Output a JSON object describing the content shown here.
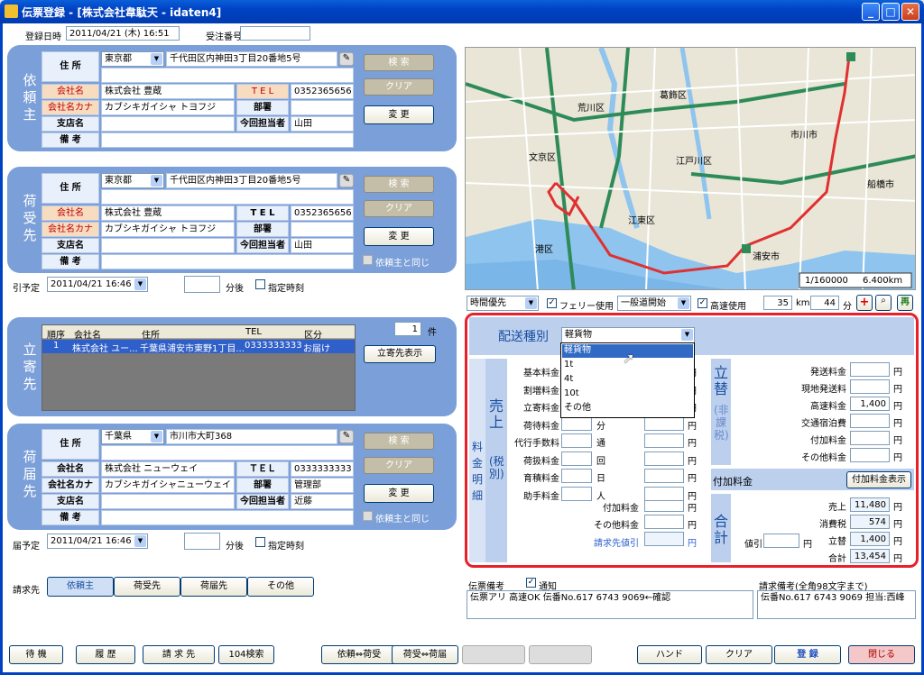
{
  "window": {
    "title": "伝票登録 - [株式会社韋駄天 - idaten4]",
    "min": "_",
    "max": "□",
    "close": "✕"
  },
  "header": {
    "reg_label": "登録日時",
    "reg_value": "2011/04/21 (木) 16:51",
    "order_label": "受注番号",
    "order_value": ""
  },
  "labels": {
    "address": "住 所",
    "company": "会社名",
    "kana": "会社名カナ",
    "tel": "T E L",
    "dept": "部署",
    "branch": "支店名",
    "person": "今回担当者",
    "note": "備 考",
    "search": "検 索",
    "clear": "クリア",
    "change": "変 更",
    "same": "依頼主と同じ",
    "min_after": "分後",
    "specify_time": "指定時刻",
    "tel2": "ＴＥＬ"
  },
  "irai": {
    "title": "依頼主",
    "pref": "東京都",
    "address": "千代田区内神田3丁目20番地5号",
    "company": "株式会社 豊蔵",
    "tel": "0352365656",
    "kana": "カブシキガイシャ トヨフジ",
    "dept": "",
    "branch": "",
    "person": "山田",
    "note": ""
  },
  "niuke": {
    "title": "荷受先",
    "pref": "東京都",
    "address": "千代田区内神田3丁目20番地5号",
    "company": "株式会社 豊蔵",
    "tel": "0352365656",
    "kana": "カブシキガイシャ トヨフジ",
    "dept": "",
    "branch": "",
    "person": "山田",
    "note": ""
  },
  "pickup": {
    "label": "引予定",
    "date": "2011/04/21 16:46",
    "min": ""
  },
  "tachiyori": {
    "title": "立寄先",
    "count": "1",
    "count_unit": "件",
    "headers": [
      "順序",
      "会社名",
      "住所",
      "TEL",
      "区分"
    ],
    "rows": [
      [
        "1",
        "株式会社 ユー...",
        "千葉県浦安市東野1丁目...",
        "0333333333",
        "お届け"
      ]
    ],
    "show_btn": "立寄先表示"
  },
  "nitodoke": {
    "title": "荷届先",
    "pref": "千葉県",
    "address": "市川市大町368",
    "company": "株式会社 ニューウェイ",
    "tel": "0333333333",
    "kana": "カブシキガイシャニューウェイ",
    "dept": "管理部",
    "branch": "",
    "person": "近藤",
    "note": ""
  },
  "delivery": {
    "label": "届予定",
    "date": "2011/04/21 16:46",
    "min": ""
  },
  "billing": {
    "label": "請求先",
    "buttons": [
      "依頼主",
      "荷受先",
      "荷届先",
      "その他"
    ]
  },
  "map": {
    "scale": "1/160000",
    "dist": "6.400km",
    "places": [
      "葛飾区",
      "荒川区",
      "江戸川区",
      "文京区",
      "市川市",
      "船橋市",
      "江東区",
      "浦安市",
      "港区"
    ]
  },
  "route": {
    "priority": "時間優先",
    "ferry": "フェリー使用",
    "general": "一般道開始",
    "highway": "高速使用",
    "km": "35",
    "km_unit": "km",
    "min": "44",
    "min_unit": "分",
    "plus": "+",
    "re": "再"
  },
  "fee": {
    "type_label": "配送種別",
    "type_value": "軽貨物",
    "options": [
      "軽貨物",
      "1t",
      "4t",
      "10t",
      "その他"
    ],
    "sales_title": "売上",
    "detail_title": "料金明細",
    "tax_title": "(税別)",
    "left_items": [
      {
        "label": "基本料金",
        "value": "",
        "unit": ""
      },
      {
        "label": "割増料金",
        "value": "",
        "unit": ""
      },
      {
        "label": "立寄料金",
        "value": "",
        "unit": ""
      },
      {
        "label": "荷待料金",
        "value": "",
        "unit": "分"
      },
      {
        "label": "代行手数料",
        "value": "",
        "unit": "通"
      },
      {
        "label": "荷扱料金",
        "value": "",
        "unit": "回"
      },
      {
        "label": "育積料金",
        "value": "",
        "unit": "日"
      },
      {
        "label": "助手料金",
        "value": "",
        "unit": "人"
      }
    ],
    "mid_values": [
      "",
      "",
      "",
      "",
      "",
      "",
      "",
      ""
    ],
    "extra": [
      {
        "label": "付加料金",
        "value": ""
      },
      {
        "label": "その他料金",
        "value": ""
      },
      {
        "label": "請求先値引",
        "value": ""
      }
    ],
    "yen": "円",
    "tate_title": "立替",
    "tate_sub": "(非課税)",
    "right_items": [
      {
        "label": "発送料金",
        "value": ""
      },
      {
        "label": "現地発送料",
        "value": ""
      },
      {
        "label": "高速料金",
        "value": "1,400"
      },
      {
        "label": "交通宿泊費",
        "value": ""
      },
      {
        "label": "付加料金",
        "value": ""
      },
      {
        "label": "その他料金",
        "value": ""
      }
    ],
    "addon_label": "付加料金",
    "addon_btn": "付加料金表示",
    "total_title": "合計",
    "discount_label": "値引",
    "discount_value": "",
    "totals": [
      {
        "label": "売上",
        "value": "11,480"
      },
      {
        "label": "消費税",
        "value": "574"
      },
      {
        "label": "立替",
        "value": "1,400"
      },
      {
        "label": "合計",
        "value": "13,454"
      }
    ]
  },
  "memo": {
    "label": "伝票備考",
    "notify": "通知",
    "text": "伝票アリ 高速OK 伝番No.617 6743 9069←確認",
    "bill_label": "請求備考(全角98文字まで)",
    "bill_text": "伝番No.617 6743 9069 担当:西峰"
  },
  "footer": {
    "left": [
      "待 機",
      "履 歴",
      "請 求 先",
      "104検索"
    ],
    "mid": [
      "依頼⇔荷受",
      "荷受⇔荷届",
      "",
      ""
    ],
    "right": [
      "ハンド",
      "クリア",
      "登 録",
      "閉じる"
    ]
  }
}
